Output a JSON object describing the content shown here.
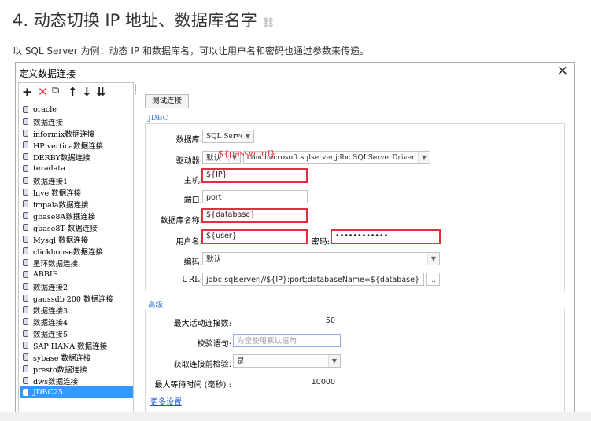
{
  "heading": {
    "title": "4. 动态切换 IP 地址、数据库名字",
    "link_glyph": "⛓"
  },
  "intro": "以 SQL Server 为例：动态 IP 和数据库名，可以让用户名和密码也通过参数来传递。",
  "dialog": {
    "title": "定义数据连接",
    "close": "✕",
    "toolbar": [
      "+",
      "✕",
      "⧉",
      "↑",
      "↓",
      "⇊"
    ],
    "connections": [
      "oracle",
      "数据连接",
      "informix数据连接",
      "HP vertica数据连接",
      "DERBY数据连接",
      "teradata",
      "数据连接1",
      "hive 数据连接",
      "impala数据连接",
      "gbase8A数据连接",
      "gbase8T 数据连接",
      "Mysql 数据连接",
      "clickhouse数据连接",
      "星环数据连接",
      "ABBIE",
      "数据连接2",
      "gaussdb 200 数据连接",
      "数据连接3",
      "数据连接4",
      "数据连接5",
      "SAP HANA 数据连接",
      "sybase 数据连接",
      "presto数据连接",
      "dws数据连接",
      "JDBC25"
    ],
    "selected_index": 24,
    "test_button": "测试连接",
    "jdbc": {
      "section": "JDBC",
      "database_label": "数据库:",
      "database_value": "SQL Server",
      "driver_label": "驱动器:",
      "driver_mode": "默认",
      "driver_value": "com.microsoft.sqlserver.jdbc.SQLServerDriver",
      "host_label": "主机:",
      "host_value": "${IP}",
      "port_label": "端口:",
      "port_value": "port",
      "dbname_label": "数据库名称:",
      "dbname_value": "${database}",
      "user_label": "用户名:",
      "user_value": "${user}",
      "password_label": "密码:",
      "password_value": "••••••••••••",
      "encoding_label": "编码:",
      "encoding_value": "默认",
      "url_label": "URL:",
      "url_value": "jdbc:sqlserver://${IP}:port;databaseName=${database}",
      "url_btn": "..."
    },
    "annotation": "${password}",
    "advanced": {
      "section": "高级",
      "max_active_label": "最大活动连接数:",
      "max_active_value": "50",
      "validation_label": "校验语句:",
      "validation_placeholder": "为空使用默认语句",
      "test_before_label": "获取连接前检验:",
      "test_before_value": "是",
      "max_wait_label": "最大等待时间 (毫秒) :",
      "max_wait_value": "10000",
      "more_link": "更多设置"
    }
  },
  "colors": {
    "highlight_red": "#e0303e",
    "selection_blue": "#3399ff",
    "section_blue": "#3b7bd8",
    "link_blue": "#2257c5"
  }
}
